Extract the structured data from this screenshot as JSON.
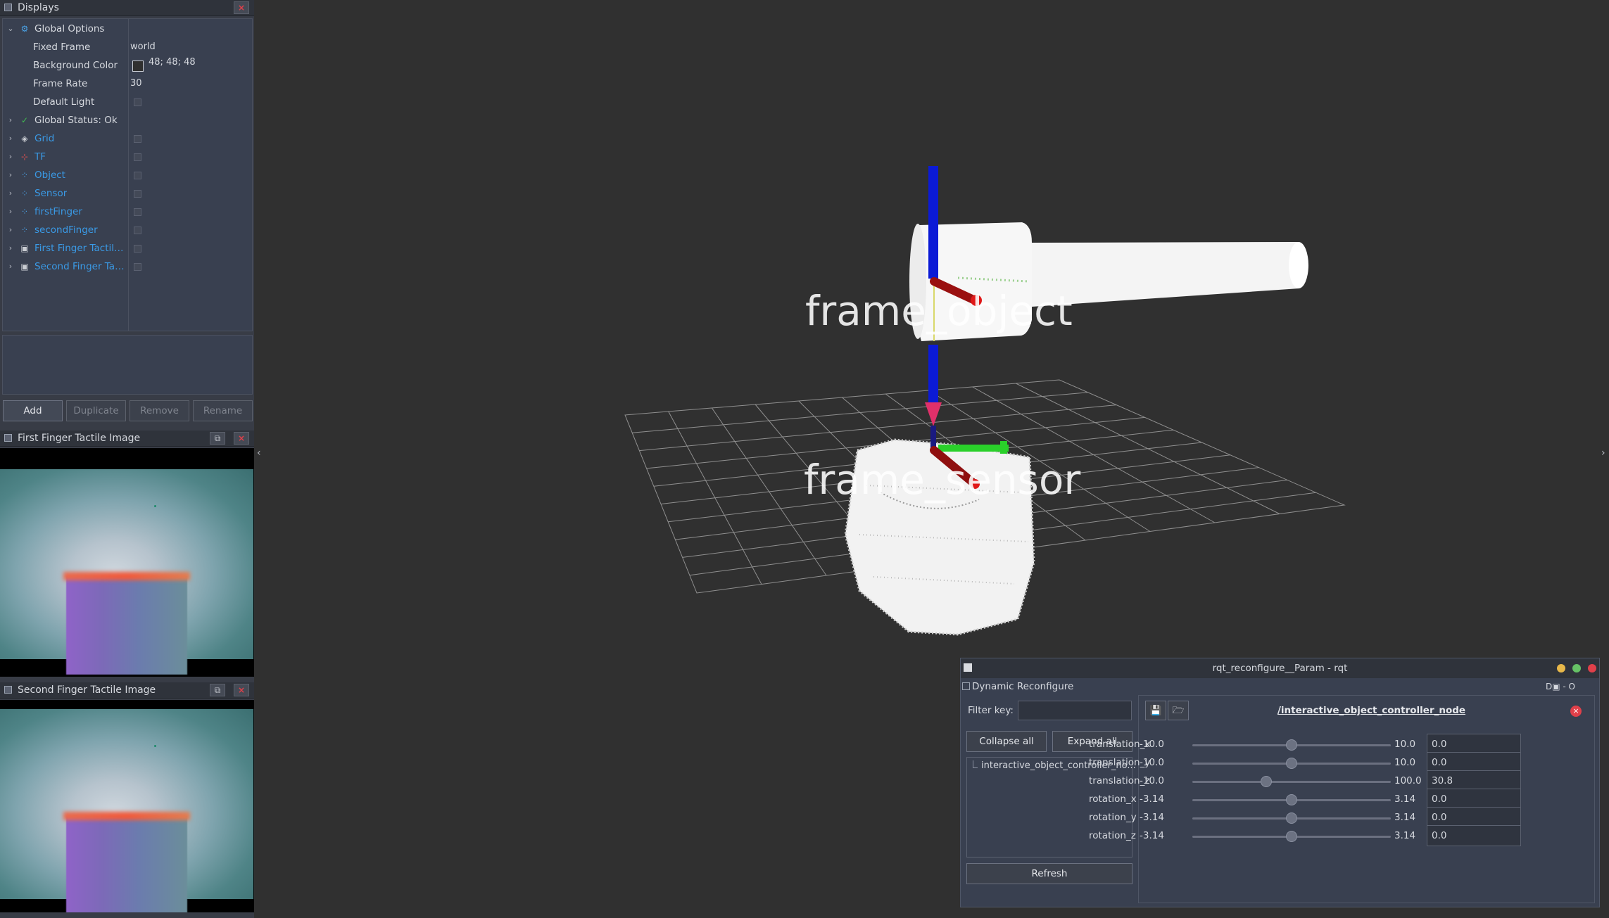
{
  "displays_panel": {
    "title": "Displays",
    "close_icon": "×",
    "rows": [
      {
        "label": "Global Options",
        "type": "group",
        "icon": "gear-icon"
      },
      {
        "label": "Fixed Frame",
        "value": "world"
      },
      {
        "label": "Background Color",
        "value": "48; 48; 48",
        "swatch": "#303030"
      },
      {
        "label": "Frame Rate",
        "value": "30"
      },
      {
        "label": "Default Light"
      },
      {
        "label": "Global Status: Ok",
        "icon": "check-icon"
      },
      {
        "label": "Grid",
        "icon": "grid-icon"
      },
      {
        "label": "TF",
        "icon": "tf-icon"
      },
      {
        "label": "Object",
        "icon": "pointcloud-icon"
      },
      {
        "label": "Sensor",
        "icon": "pointcloud-icon"
      },
      {
        "label": "firstFinger",
        "icon": "pointcloud-icon"
      },
      {
        "label": "secondFinger",
        "icon": "pointcloud-icon"
      },
      {
        "label": "First Finger Tactile I...",
        "icon": "image-icon"
      },
      {
        "label": "Second Finger Tacti...",
        "icon": "image-icon"
      }
    ],
    "buttons": {
      "add": "Add",
      "duplicate": "Duplicate",
      "remove": "Remove",
      "rename": "Rename"
    }
  },
  "first_image_panel": {
    "title": "First Finger Tactile Image"
  },
  "second_image_panel": {
    "title": "Second Finger Tactile Image"
  },
  "scene": {
    "label_object": "frame_object",
    "label_sensor": "frame_sensor",
    "colors": {
      "x_axis": "#b01818",
      "y_axis": "#18c818",
      "z_axis": "#0b1ad6",
      "grid": "#a0a0a0"
    }
  },
  "rqt": {
    "window_title": "rqt_reconfigure__Param - rqt",
    "plugin_title": "Dynamic Reconfigure",
    "plugin_controls": "D▣ - O",
    "filter_label": "Filter key:",
    "filter_value": "",
    "collapse_all": "Collapse all",
    "expand_all": "Expand all",
    "tree_item": "interactive_object_controller_no...",
    "refresh": "Refresh",
    "node_title": "/interactive_object_controller_node",
    "params": [
      {
        "name": "translation_x",
        "min": "-10.0",
        "max": "10.0",
        "value": "0.0",
        "fraction": 0.5
      },
      {
        "name": "translation_y",
        "min": "-10.0",
        "max": "10.0",
        "value": "0.0",
        "fraction": 0.5
      },
      {
        "name": "translation_z",
        "min": "-10.0",
        "max": "100.0",
        "value": "30.8",
        "fraction": 0.371
      },
      {
        "name": "rotation_x",
        "min": "-3.14",
        "max": "3.14",
        "value": "0.0",
        "fraction": 0.5
      },
      {
        "name": "rotation_y",
        "min": "-3.14",
        "max": "3.14",
        "value": "0.0",
        "fraction": 0.5
      },
      {
        "name": "rotation_z",
        "min": "-3.14",
        "max": "3.14",
        "value": "0.0",
        "fraction": 0.5
      }
    ]
  }
}
